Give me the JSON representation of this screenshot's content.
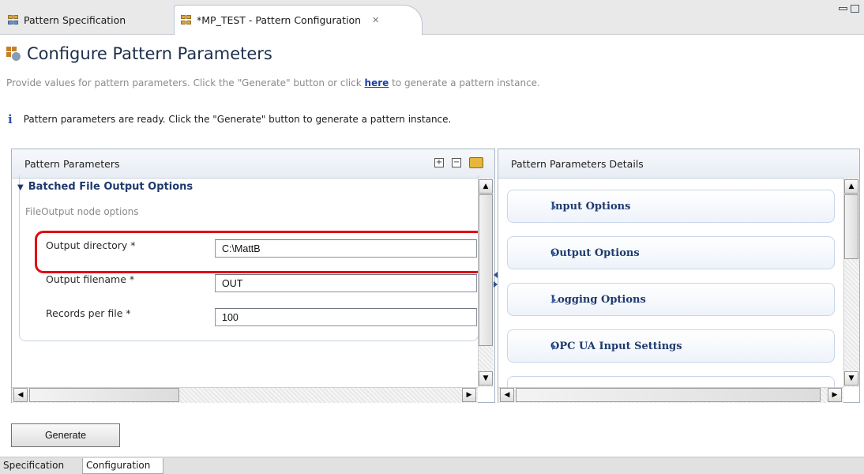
{
  "tabs": {
    "spec_label": "Pattern Specification",
    "config_label": "*MP_TEST - Pattern Configuration"
  },
  "header": {
    "title": "Configure Pattern Parameters",
    "description_before": "Provide values for pattern parameters. Click the \"Generate\" button or click",
    "description_link": "here",
    "description_after": "to generate a pattern instance.",
    "info_message": "Pattern parameters are ready. Click the \"Generate\" button to generate a pattern instance."
  },
  "left_panel": {
    "title": "Pattern Parameters",
    "section_title": "Batched File Output Options",
    "section_subtitle": "FileOutput node options",
    "fields": [
      {
        "label": "Output directory *",
        "value": "C:\\MattB"
      },
      {
        "label": "Output filename *",
        "value": "OUT"
      },
      {
        "label": "Records per file *",
        "value": "100"
      }
    ]
  },
  "right_panel": {
    "title": "Pattern Parameters Details",
    "cards": [
      "Input Options",
      "Output Options",
      "Logging Options",
      "OPC UA Input Settings"
    ]
  },
  "actions": {
    "generate_label": "Generate"
  },
  "bottom_tabs": [
    "Specification",
    "Configuration"
  ],
  "colors": {
    "highlight": "#e20b14",
    "section_text": "#1f3a6d",
    "link": "#1a3ea8"
  }
}
